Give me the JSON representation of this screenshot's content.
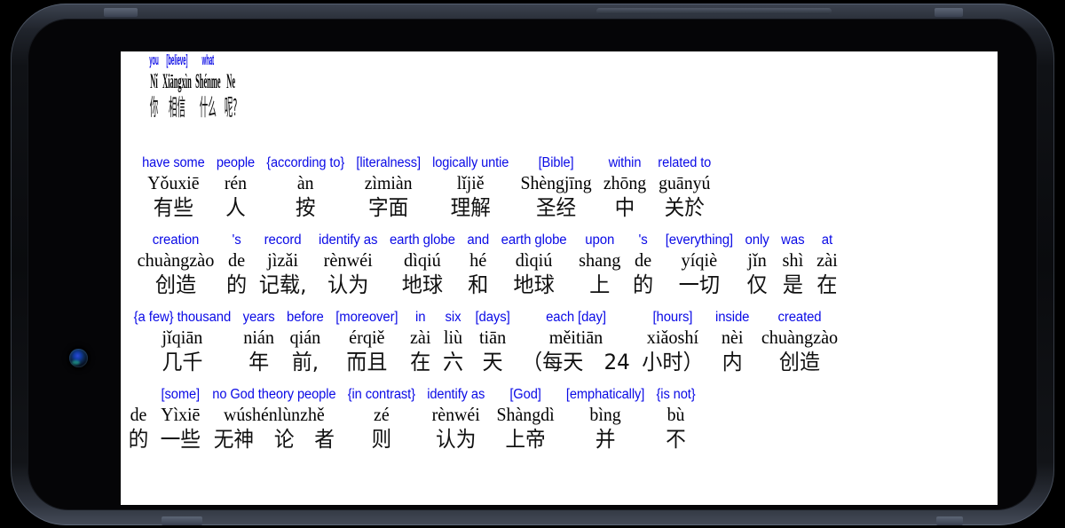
{
  "device": {
    "type": "smartphone-landscape",
    "frame_color": "#14171c",
    "screen_background": "#ffffff"
  },
  "colors": {
    "gloss_blue": "#0a0ae6",
    "text_black": "#000000",
    "frame_dark": "#0a0b0e",
    "button_gray": "#5c6575"
  },
  "title": {
    "words": [
      {
        "gloss": "you",
        "pinyin": "Nǐ",
        "hanzi": "你"
      },
      {
        "gloss": "[believe]",
        "pinyin": "Xiāngxìn",
        "hanzi": "相信"
      },
      {
        "gloss": "what",
        "pinyin": "Shénme",
        "hanzi": "什么"
      },
      {
        "gloss": "",
        "pinyin": "Ne",
        "hanzi": "呢?"
      }
    ]
  },
  "body": {
    "rows": [
      {
        "words": [
          {
            "gloss": "have some",
            "pinyin": "Yǒuxiē",
            "hanzi": "有些"
          },
          {
            "gloss": "people",
            "pinyin": "rén",
            "hanzi": "人"
          },
          {
            "gloss": "{according to}",
            "pinyin": "àn",
            "hanzi": "按"
          },
          {
            "gloss": "[literalness]",
            "pinyin": "zìmiàn",
            "hanzi": "字面"
          },
          {
            "gloss": "logically untie",
            "pinyin": "lǐjiě",
            "hanzi": "理解"
          },
          {
            "gloss": "[Bible]",
            "pinyin": "Shèngjīng",
            "hanzi": "圣经"
          },
          {
            "gloss": "within",
            "pinyin": "zhōng",
            "hanzi": "中"
          },
          {
            "gloss": "related to",
            "pinyin": "guānyú",
            "hanzi": "关於"
          }
        ]
      },
      {
        "words": [
          {
            "gloss": "creation",
            "pinyin": "chuàngzào",
            "hanzi": "创造"
          },
          {
            "gloss": "'s",
            "pinyin": "de",
            "hanzi": "的"
          },
          {
            "gloss": "record",
            "pinyin": "jìzǎi",
            "hanzi": "记载,"
          },
          {
            "gloss": "identify as",
            "pinyin": "rènwéi",
            "hanzi": "认为"
          },
          {
            "gloss": "earth globe",
            "pinyin": "dìqiú",
            "hanzi": "地球"
          },
          {
            "gloss": "and",
            "pinyin": "hé",
            "hanzi": "和"
          },
          {
            "gloss": "earth globe",
            "pinyin": "dìqiú",
            "hanzi": "地球"
          },
          {
            "gloss": "upon",
            "pinyin": "shang",
            "hanzi": "上"
          },
          {
            "gloss": "'s",
            "pinyin": "de",
            "hanzi": "的"
          },
          {
            "gloss": "[everything]",
            "pinyin": "yíqiè",
            "hanzi": "一切"
          },
          {
            "gloss": "only",
            "pinyin": "jǐn",
            "hanzi": "仅"
          },
          {
            "gloss": "was",
            "pinyin": "shì",
            "hanzi": "是"
          },
          {
            "gloss": "at",
            "pinyin": "zài",
            "hanzi": "在"
          }
        ]
      },
      {
        "words": [
          {
            "gloss": "{a few} thousand",
            "pinyin": "jǐqiān",
            "hanzi": "几千"
          },
          {
            "gloss": "years",
            "pinyin": "nián",
            "hanzi": "年"
          },
          {
            "gloss": "before",
            "pinyin": "qián",
            "hanzi": "前,"
          },
          {
            "gloss": "[moreover]",
            "pinyin": "érqiě",
            "hanzi": "而且"
          },
          {
            "gloss": "in",
            "pinyin": "zài",
            "hanzi": "在"
          },
          {
            "gloss": "six",
            "pinyin": "liù",
            "hanzi": "六"
          },
          {
            "gloss": "[days]",
            "pinyin": "tiān",
            "hanzi": "天"
          },
          {
            "gloss": "each [day]",
            "pinyin": "měitiān",
            "hanzi": "（每天　24"
          },
          {
            "gloss": "[hours]",
            "pinyin": "xiǎoshí",
            "hanzi": "小时）"
          },
          {
            "gloss": "inside",
            "pinyin": "nèi",
            "hanzi": "内"
          },
          {
            "gloss": "created",
            "pinyin": "chuàngzào",
            "hanzi": "创造"
          }
        ]
      },
      {
        "words": [
          {
            "gloss": "",
            "pinyin": "de",
            "hanzi": "的"
          },
          {
            "gloss": "[some]",
            "pinyin": "Yìxiē",
            "hanzi": "一些"
          },
          {
            "gloss": "no God theory people",
            "pinyin": "wúshénlùnzhě",
            "hanzi": "无神　论　者"
          },
          {
            "gloss": "{in contrast}",
            "pinyin": "zé",
            "hanzi": "则"
          },
          {
            "gloss": "identify as",
            "pinyin": "rènwéi",
            "hanzi": "认为"
          },
          {
            "gloss": "[God]",
            "pinyin": "Shàngdì",
            "hanzi": "上帝"
          },
          {
            "gloss": "[emphatically]",
            "pinyin": "bìng",
            "hanzi": "并"
          },
          {
            "gloss": "{is not}",
            "pinyin": "bù",
            "hanzi": "不"
          }
        ]
      }
    ]
  }
}
